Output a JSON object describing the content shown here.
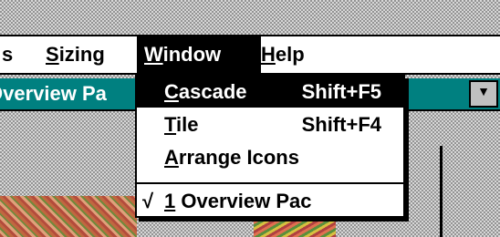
{
  "menubar": {
    "items": [
      {
        "prefix": "",
        "accel": "",
        "rest": "s"
      },
      {
        "prefix": "",
        "accel": "S",
        "rest": "izing"
      },
      {
        "prefix": "",
        "accel": "W",
        "rest": "indow"
      },
      {
        "prefix": "",
        "accel": "H",
        "rest": "elp"
      }
    ]
  },
  "child_window": {
    "title": "Overview Pa"
  },
  "window_menu": {
    "items": [
      {
        "accel": "C",
        "rest": "ascade",
        "shortcut": "Shift+F5"
      },
      {
        "accel": "T",
        "rest": "ile",
        "shortcut": "Shift+F4"
      },
      {
        "accel": "A",
        "rest": "rrange Icons",
        "shortcut": ""
      }
    ],
    "window_list": {
      "check": "√",
      "accel": "1",
      "rest": " Overview Pac"
    }
  },
  "colors": {
    "titlebar": "#008080",
    "highlight": "#000000"
  }
}
